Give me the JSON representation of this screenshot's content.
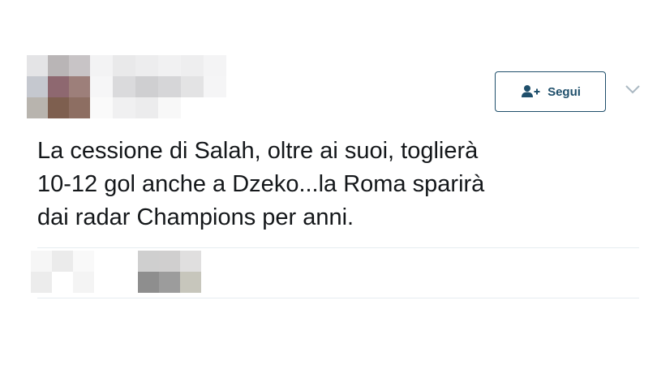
{
  "header": {
    "follow_button_label": "Segui",
    "follow_icon": "add-user-icon",
    "menu_icon": "chevron-down-icon"
  },
  "tweet": {
    "text": "La cessione di Salah, oltre ai suoi, toglierà\n10-12 gol anche a Dzeko...la Roma sparirà\ndai radar Champions per anni."
  },
  "colors": {
    "accent": "#1f4f6b",
    "text": "#14171a",
    "divider": "#e6ecf0"
  }
}
